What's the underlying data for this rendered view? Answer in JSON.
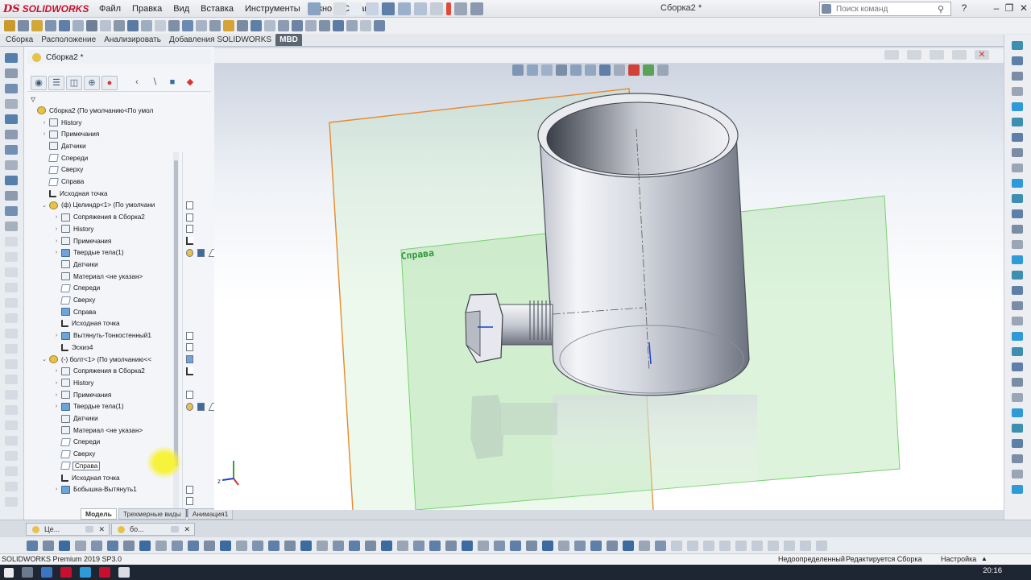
{
  "app": {
    "logo_text": "SOLIDWORKS",
    "doc_title": "Сборка2 *",
    "menu": [
      "Файл",
      "Правка",
      "Вид",
      "Вставка",
      "Инструменты",
      "Окно",
      "Справка"
    ],
    "search_placeholder": "Поиск команд"
  },
  "command_tabs": [
    "Сборка",
    "Расположение",
    "Анализировать",
    "Добавления SOLIDWORKS",
    "MBD"
  ],
  "active_command_tab": "MBD",
  "feature_manager": {
    "header": "Сборка2 *",
    "tree": [
      {
        "label": "Сборка2  (По умолчанию<По умол",
        "icon": "asm",
        "indent": 0,
        "tw": "",
        "c2": ""
      },
      {
        "label": "History",
        "icon": "box",
        "indent": 1,
        "tw": "›",
        "c2": ""
      },
      {
        "label": "Примечания",
        "icon": "box",
        "indent": 1,
        "tw": "›",
        "c2": ""
      },
      {
        "label": "Датчики",
        "icon": "box",
        "indent": 1,
        "tw": "",
        "c2": ""
      },
      {
        "label": "Спереди",
        "icon": "plane",
        "indent": 1,
        "tw": "",
        "c2": "plane"
      },
      {
        "label": "Сверху",
        "icon": "plane",
        "indent": 1,
        "tw": "",
        "c2": "plane"
      },
      {
        "label": "Справа",
        "icon": "plane",
        "indent": 1,
        "tw": "",
        "c2": "plane"
      },
      {
        "label": "Исходная точка",
        "icon": "org",
        "indent": 1,
        "tw": "",
        "c2": "org"
      },
      {
        "label": "(ф) Целиндр<1> (По умолчани",
        "icon": "asm",
        "indent": 1,
        "tw": "⌄",
        "c2": "asm"
      },
      {
        "label": "Сопряжения в Сборка2",
        "icon": "box",
        "indent": 2,
        "tw": "›",
        "c2": ""
      },
      {
        "label": "History",
        "icon": "box",
        "indent": 2,
        "tw": "›",
        "c2": ""
      },
      {
        "label": "Примечания",
        "icon": "box",
        "indent": 2,
        "tw": "›",
        "c2": ""
      },
      {
        "label": "Твердые тела(1)",
        "icon": "part",
        "indent": 2,
        "tw": "›",
        "c2": ""
      },
      {
        "label": "Датчики",
        "icon": "box",
        "indent": 2,
        "tw": "",
        "c2": ""
      },
      {
        "label": "Материал <не указан>",
        "icon": "box",
        "indent": 2,
        "tw": "",
        "c2": ""
      },
      {
        "label": "Спереди",
        "icon": "plane",
        "indent": 2,
        "tw": "",
        "c2": "plane"
      },
      {
        "label": "Сверху",
        "icon": "plane",
        "indent": 2,
        "tw": "",
        "c2": "plane"
      },
      {
        "label": "Справа",
        "icon": "part",
        "indent": 2,
        "tw": "",
        "c2": "part"
      },
      {
        "label": "Исходная точка",
        "icon": "org",
        "indent": 2,
        "tw": "",
        "c2": "org"
      },
      {
        "label": "Вытянуть-Тонкостенный1",
        "icon": "part",
        "indent": 2,
        "tw": "›",
        "c2": ""
      },
      {
        "label": "Эскиз4",
        "icon": "org",
        "indent": 2,
        "tw": "",
        "c2": "plane"
      },
      {
        "label": "(-) болт<1> (По умолчанию<<",
        "icon": "asm",
        "indent": 1,
        "tw": "⌄",
        "c2": "asm"
      },
      {
        "label": "Сопряжения в Сборка2",
        "icon": "box",
        "indent": 2,
        "tw": "›",
        "c2": ""
      },
      {
        "label": "History",
        "icon": "box",
        "indent": 2,
        "tw": "›",
        "c2": ""
      },
      {
        "label": "Примечания",
        "icon": "box",
        "indent": 2,
        "tw": "›",
        "c2": ""
      },
      {
        "label": "Твердые тела(1)",
        "icon": "part",
        "indent": 2,
        "tw": "›",
        "c2": ""
      },
      {
        "label": "Датчики",
        "icon": "box",
        "indent": 2,
        "tw": "",
        "c2": ""
      },
      {
        "label": "Материал <не указан>",
        "icon": "box",
        "indent": 2,
        "tw": "",
        "c2": ""
      },
      {
        "label": "Спереди",
        "icon": "plane",
        "indent": 2,
        "tw": "",
        "c2": "plane"
      },
      {
        "label": "Сверху",
        "icon": "plane",
        "indent": 2,
        "tw": "",
        "c2": "plane"
      },
      {
        "label": "Справа",
        "icon": "plane",
        "indent": 2,
        "tw": "",
        "c2": "part",
        "selected": true
      },
      {
        "label": "Исходная точка",
        "icon": "org",
        "indent": 2,
        "tw": "",
        "c2": "org"
      },
      {
        "label": "Бобышка-Вытянуть1",
        "icon": "part",
        "indent": 2,
        "tw": "›",
        "c2": ""
      }
    ],
    "bottom_tabs": [
      "Модель",
      "Трехмерные виды",
      "Анимация1"
    ],
    "active_bottom_tab": "Модель"
  },
  "viewport": {
    "plane_label": "Справа"
  },
  "doc_tabs": [
    "Це...",
    "бо..."
  ],
  "status": {
    "product": "SOLIDWORKS Premium 2019 SP3.0",
    "state1": "Недоопределенный",
    "state2": "Редактируется Сборка",
    "settings": "Настройка"
  },
  "taskbar": {
    "clock": "20:16"
  },
  "colors": {
    "accent": "#c8102e",
    "plane_green": "#9ddc97",
    "plane_orange": "#e8892b",
    "part_blue": "#6fa4d9",
    "assembly_yellow": "#e7c24a"
  }
}
